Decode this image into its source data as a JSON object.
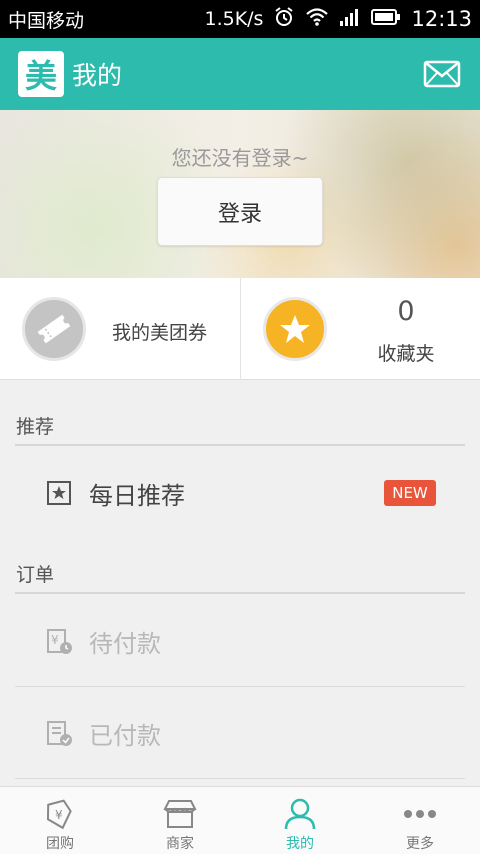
{
  "status_bar": {
    "carrier": "中国移动",
    "speed": "1.5K/s",
    "time": "12:13"
  },
  "header": {
    "logo_text": "美",
    "title": "我的"
  },
  "banner": {
    "message": "您还没有登录~",
    "login_label": "登录"
  },
  "cards": {
    "coupon_label": "我的美团券",
    "favorites_count": "0",
    "favorites_label": "收藏夹"
  },
  "sections": {
    "recommend_title": "推荐",
    "daily_recommend_label": "每日推荐",
    "new_badge": "NEW",
    "orders_title": "订单",
    "pending_payment_label": "待付款",
    "paid_label": "已付款"
  },
  "bottom_nav": {
    "items": [
      {
        "label": "团购"
      },
      {
        "label": "商家"
      },
      {
        "label": "我的"
      },
      {
        "label": "更多"
      }
    ],
    "active_index": 2
  },
  "colors": {
    "brand": "#2dbbad",
    "badge": "#e8553a",
    "favorite": "#f6b424"
  }
}
